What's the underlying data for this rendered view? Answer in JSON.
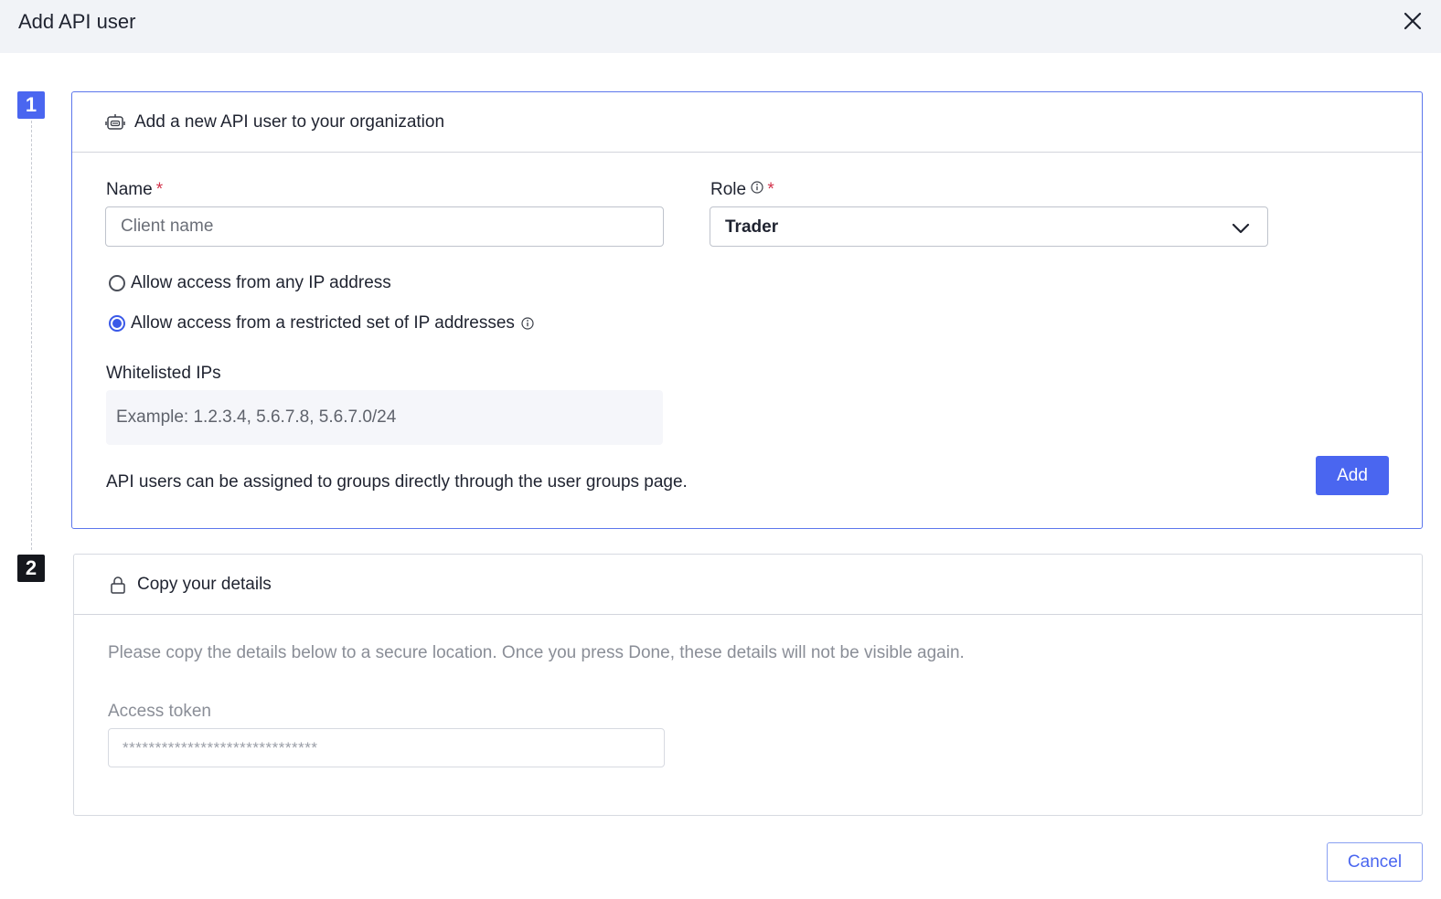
{
  "dialog": {
    "title": "Add API user"
  },
  "steps": {
    "step1": {
      "number": "1",
      "title": "Add a new API user to your organization",
      "name_label": "Name",
      "name_required": "*",
      "name_placeholder": "Client name",
      "name_value": "",
      "role_label": "Role",
      "role_required": "*",
      "role_value": "Trader",
      "ip_options": [
        {
          "label": "Allow access from any IP address",
          "selected": false
        },
        {
          "label": "Allow access from a restricted set of IP addresses",
          "selected": true
        }
      ],
      "whitelist_label": "Whitelisted IPs",
      "whitelist_placeholder": "Example: 1.2.3.4, 5.6.7.8, 5.6.7.0/24",
      "groups_hint": "API users can be assigned to groups directly through the user groups page.",
      "add_button": "Add"
    },
    "step2": {
      "number": "2",
      "title": "Copy your details",
      "description": "Please copy the details below to a secure location. Once you press Done, these details will not be visible again.",
      "token_label": "Access token",
      "token_value": "******************************"
    }
  },
  "footer": {
    "cancel_button": "Cancel"
  },
  "icons": {
    "close": "close-icon",
    "robot": "robot-icon",
    "lock": "lock-icon",
    "info": "info-icon",
    "chevron": "chevron-down-icon"
  },
  "colors": {
    "accent": "#4a66f0",
    "required": "#d2334b",
    "header_bg": "#f1f3f7"
  }
}
